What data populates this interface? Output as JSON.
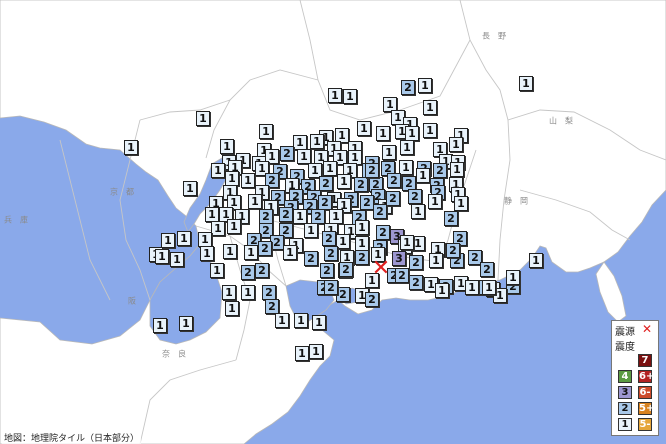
{
  "map": {
    "colors": {
      "sea": "#8aa9ea",
      "land": "#ffffff",
      "border": "#c9c9c9"
    }
  },
  "pref_labels": [
    "長　野",
    "山　梨",
    "静　岡",
    "京　都",
    "兵　庫",
    "阪",
    "奈　良"
  ],
  "epicenter": {
    "symbol": "✕",
    "color": "#e02020"
  },
  "legend": {
    "epicenter_label": "震源",
    "epicenter_mark": "✕",
    "intensity_label": "震度",
    "items": [
      {
        "value": "7",
        "color": "#7a1010",
        "text_color": "#ffffff"
      },
      {
        "value": "6+",
        "color": "#b22222",
        "text_color": "#ffffff"
      },
      {
        "value": "6-",
        "color": "#cc4a2a",
        "text_color": "#ffffff"
      },
      {
        "value": "5+",
        "color": "#d8821f",
        "text_color": "#ffffff"
      },
      {
        "value": "5-",
        "color": "#e5a63b",
        "text_color": "#ffffff"
      },
      {
        "value": "4",
        "color": "#5b9b43",
        "text_color": "#ffffff"
      },
      {
        "value": "3",
        "color": "#9d97d1",
        "text_color": "#111111"
      },
      {
        "value": "2",
        "color": "#a9c9ea",
        "text_color": "#111111"
      },
      {
        "value": "1",
        "color": "#e9f3fb",
        "text_color": "#111111"
      }
    ]
  },
  "credit": "地図：地理院タイル（日本部分）",
  "intensity_colors": {
    "1": "#e9f3fb",
    "2": "#a9c9ea",
    "3": "#9d97d1",
    "4": "#5b9b43"
  }
}
